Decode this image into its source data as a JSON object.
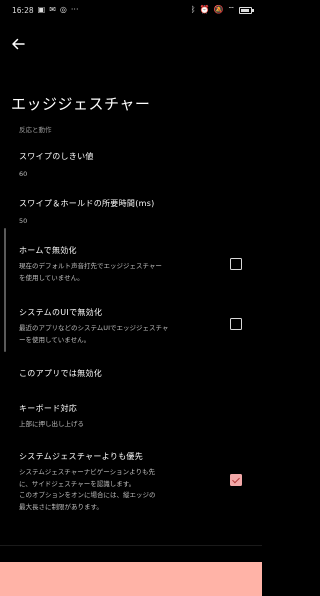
{
  "status_bar": {
    "time": "16:28",
    "left_icons": [
      "notification-icon",
      "mail-icon",
      "messenger-icon",
      "more-icon"
    ],
    "right_icons": [
      "bluetooth-icon",
      "alarm-icon",
      "mute-icon",
      "wifi-icon",
      "battery-icon"
    ],
    "left_glyphs": [
      "▣",
      "✉",
      "◎",
      "···"
    ],
    "right_glyphs": [
      "ᛒ",
      "⏰",
      "🔕",
      "⌔"
    ],
    "battery_level": 0.85
  },
  "header": {
    "back_icon": "arrow-left-icon",
    "title": "エッジジェスチャー"
  },
  "section": {
    "label": "反応と動作"
  },
  "settings": {
    "swipe_threshold": {
      "title": "スワイプのしきい値",
      "value": "60"
    },
    "swipe_hold": {
      "title": "スワイプ＆ホールドの所要時間(ms)",
      "value": "50"
    },
    "disable_home": {
      "title": "ホームで無効化",
      "desc_1": "現在のデフォルト声音打先でエッジジェスチャー",
      "desc_2": "を使用していません。",
      "checked": false
    },
    "disable_system_ui": {
      "title": "システムのUIで無効化",
      "desc_1": "最近のアプリなどのシステムUIでエッジジェスチャ",
      "desc_2": "ーを使用していません。",
      "checked": false
    },
    "disable_this_app": {
      "title": "このアプリでは無効化"
    },
    "keyboard": {
      "title": "キーボード対応",
      "desc": "上部に押し出し上げる"
    },
    "prefer_system": {
      "title": "システムジェスチャーよりも優先",
      "desc_1": "システムジェスチャーナビゲーションよりも先",
      "desc_2": "に、サイドジェスチャーを認識します。",
      "desc_3": "このオプションをオンに場合には、縦エッジの",
      "desc_4": "最大長さに制限があります。",
      "checked": true
    }
  }
}
